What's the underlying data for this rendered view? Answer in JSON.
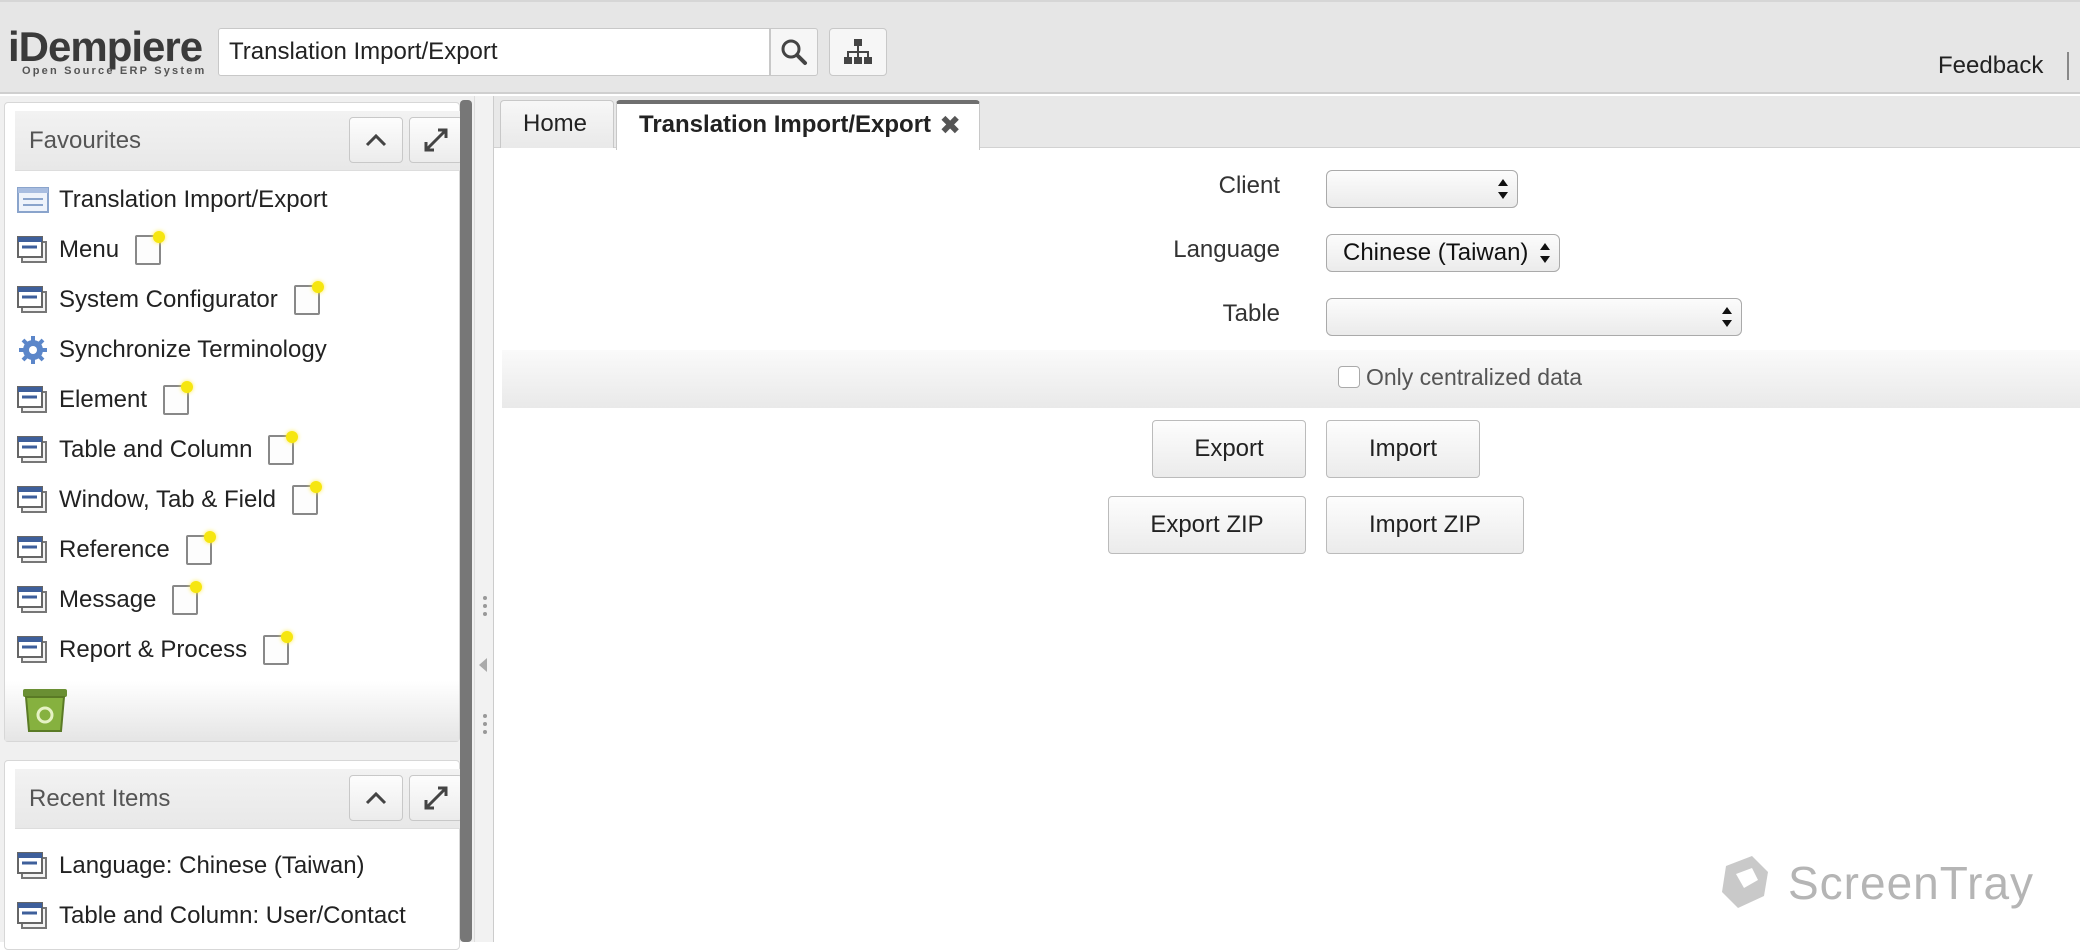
{
  "header": {
    "logo_text": "iDempiere",
    "logo_tagline": "Open Source ERP System",
    "search_value": "Translation Import/Export",
    "feedback": "Feedback"
  },
  "favourites": {
    "title": "Favourites",
    "items": [
      {
        "label": "Translation Import/Export",
        "icon": "form-icon",
        "note": false
      },
      {
        "label": "Menu",
        "icon": "window-icon",
        "note": true
      },
      {
        "label": "System Configurator",
        "icon": "window-icon",
        "note": true
      },
      {
        "label": "Synchronize Terminology",
        "icon": "gear-icon",
        "note": false
      },
      {
        "label": "Element",
        "icon": "window-icon",
        "note": true
      },
      {
        "label": "Table and Column",
        "icon": "window-icon",
        "note": true
      },
      {
        "label": "Window, Tab & Field",
        "icon": "window-icon",
        "note": true
      },
      {
        "label": "Reference",
        "icon": "window-icon",
        "note": true
      },
      {
        "label": "Message",
        "icon": "window-icon",
        "note": true
      },
      {
        "label": "Report & Process",
        "icon": "window-icon",
        "note": true
      }
    ]
  },
  "recent": {
    "title": "Recent Items",
    "items": [
      {
        "label": "Language: Chinese (Taiwan)",
        "icon": "window-icon"
      },
      {
        "label": "Table and Column: User/Contact",
        "icon": "window-icon"
      }
    ]
  },
  "tabs": {
    "home": "Home",
    "active": "Translation Import/Export"
  },
  "form": {
    "client_label": "Client",
    "client_value": "",
    "language_label": "Language",
    "language_value": "Chinese (Taiwan)",
    "table_label": "Table",
    "table_value": "",
    "only_centralized_label": "Only centralized data",
    "only_centralized_checked": false,
    "export": "Export",
    "import": "Import",
    "export_zip": "Export ZIP",
    "import_zip": "Import ZIP"
  },
  "watermark": "ScreenTray"
}
